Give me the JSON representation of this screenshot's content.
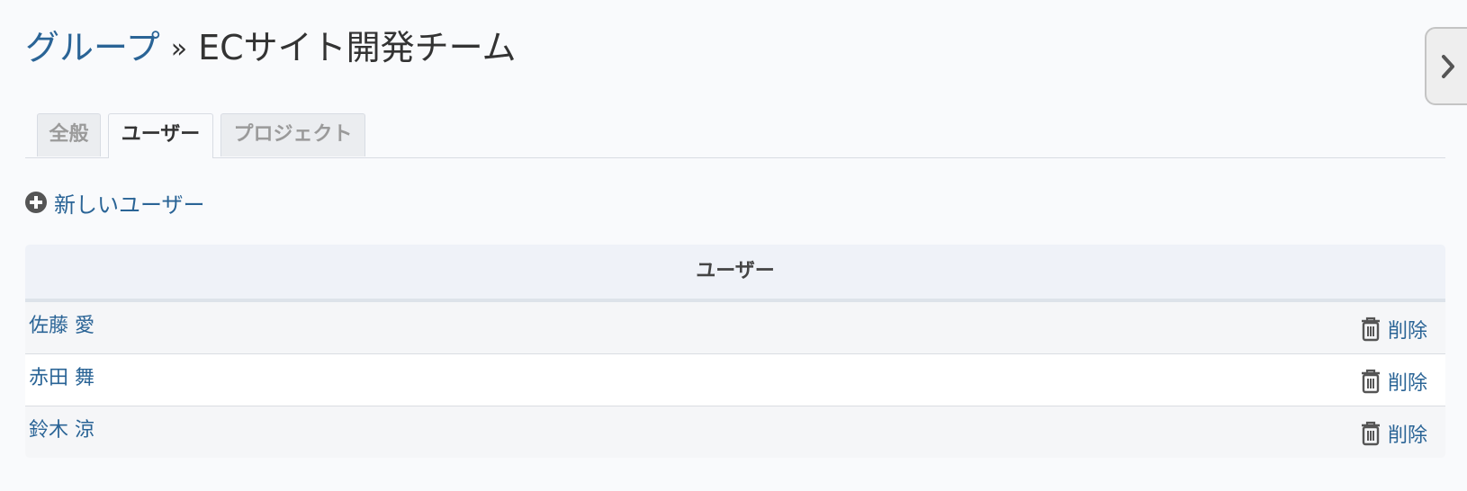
{
  "breadcrumb": {
    "parent_label": "グループ",
    "separator": "»",
    "current_label": "ECサイト開発チーム"
  },
  "tabs": [
    {
      "label": "全般",
      "active": false
    },
    {
      "label": "ユーザー",
      "active": true
    },
    {
      "label": "プロジェクト",
      "active": false
    }
  ],
  "actions": {
    "new_user_label": "新しいユーザー",
    "new_user_icon": "plus-circle-icon"
  },
  "table": {
    "header": "ユーザー",
    "rows": [
      {
        "name": "佐藤 愛",
        "action_label": "削除",
        "action_icon": "trash-icon"
      },
      {
        "name": "赤田 舞",
        "action_label": "削除",
        "action_icon": "trash-icon"
      },
      {
        "name": "鈴木 涼",
        "action_label": "削除",
        "action_icon": "trash-icon"
      }
    ]
  },
  "side_toggle_icon": "chevron-right-icon",
  "colors": {
    "link": "#2a6496",
    "background": "#f9fafc",
    "table_header_bg": "#eff2f8"
  }
}
